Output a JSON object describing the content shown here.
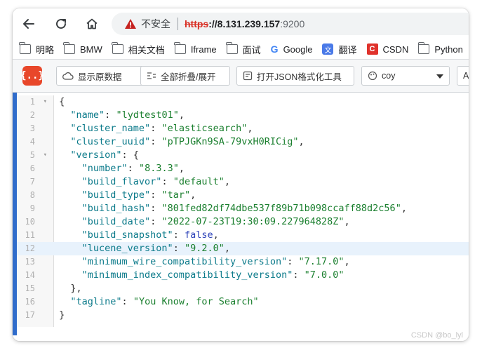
{
  "browser": {
    "insecure_label": "不安全",
    "url_scheme": "https",
    "url_sep": "://",
    "url_host": "8.131.239.157",
    "url_port": ":9200"
  },
  "bookmarks": [
    {
      "label": "明略",
      "icon": "folder-icon"
    },
    {
      "label": "BMW",
      "icon": "folder-icon"
    },
    {
      "label": "相关文档",
      "icon": "folder-icon"
    },
    {
      "label": "Iframe",
      "icon": "folder-icon"
    },
    {
      "label": "面试",
      "icon": "folder-icon"
    },
    {
      "label": "Google",
      "icon": "google-icon"
    },
    {
      "label": "翻译",
      "icon": "translate-icon"
    },
    {
      "label": "CSDN",
      "icon": "csdn-icon"
    },
    {
      "label": "Python",
      "icon": "folder-icon"
    }
  ],
  "toolbar": {
    "logo_text": "{..}",
    "show_raw": "显示原数据",
    "toggle_fold": "全部折叠/展开",
    "open_formatter": "打开JSON格式化工具",
    "theme_value": "coy",
    "extra_button": "A"
  },
  "editor": {
    "lines": [
      {
        "n": "1",
        "fold": "▾"
      },
      {
        "n": "2",
        "fold": ""
      },
      {
        "n": "3",
        "fold": ""
      },
      {
        "n": "4",
        "fold": ""
      },
      {
        "n": "5",
        "fold": "▾"
      },
      {
        "n": "6",
        "fold": ""
      },
      {
        "n": "7",
        "fold": ""
      },
      {
        "n": "8",
        "fold": ""
      },
      {
        "n": "9",
        "fold": ""
      },
      {
        "n": "10",
        "fold": ""
      },
      {
        "n": "11",
        "fold": ""
      },
      {
        "n": "12",
        "fold": ""
      },
      {
        "n": "13",
        "fold": ""
      },
      {
        "n": "14",
        "fold": ""
      },
      {
        "n": "15",
        "fold": ""
      },
      {
        "n": "16",
        "fold": ""
      },
      {
        "n": "17",
        "fold": ""
      }
    ],
    "active_line": 12
  },
  "json": {
    "open_brace": "{",
    "close_brace": "}",
    "close_inner": "},",
    "name_key": "\"name\"",
    "name_val": "\"lydtest01\"",
    "cluster_name_key": "\"cluster_name\"",
    "cluster_name_val": "\"elasticsearch\"",
    "cluster_uuid_key": "\"cluster_uuid\"",
    "cluster_uuid_val": "\"pTPJGKn9SA-79vxH0RICig\"",
    "version_key": "\"version\"",
    "number_key": "\"number\"",
    "number_val": "\"8.3.3\"",
    "build_flavor_key": "\"build_flavor\"",
    "build_flavor_val": "\"default\"",
    "build_type_key": "\"build_type\"",
    "build_type_val": "\"tar\"",
    "build_hash_key": "\"build_hash\"",
    "build_hash_val": "\"801fed82df74dbe537f89b71b098ccaff88d2c56\"",
    "build_date_key": "\"build_date\"",
    "build_date_val": "\"2022-07-23T19:30:09.227964828Z\"",
    "build_snapshot_key": "\"build_snapshot\"",
    "build_snapshot_val": "false",
    "lucene_version_key": "\"lucene_version\"",
    "lucene_version_val": "\"9.2.0\"",
    "min_wire_key": "\"minimum_wire_compatibility_version\"",
    "min_wire_val": "\"7.17.0\"",
    "min_index_key": "\"minimum_index_compatibility_version\"",
    "min_index_val": "\"7.0.0\"",
    "tagline_key": "\"tagline\"",
    "tagline_val": "\"You Know, for Search\""
  },
  "watermark": "CSDN @bo_lyl",
  "colors": {
    "accent_bar": "#2f6ccb",
    "logo_bg": "#e8472a",
    "key": "#0b7a8a",
    "string": "#1a7f2e",
    "boolean": "#2a40b8",
    "insecure_scheme": "#d93025"
  }
}
